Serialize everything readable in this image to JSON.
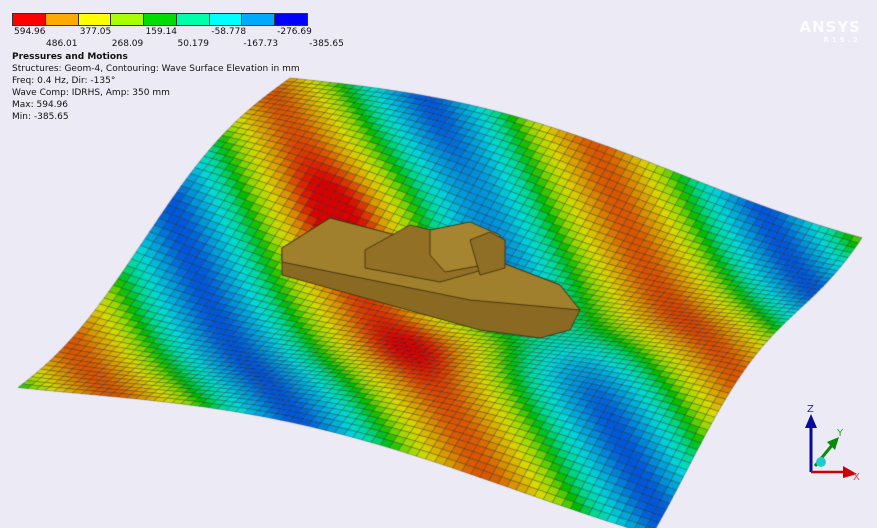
{
  "legend": {
    "colors": [
      "#ff0000",
      "#ffaa00",
      "#ffff00",
      "#aaff00",
      "#00dd00",
      "#00ffaa",
      "#00ffff",
      "#00aaff",
      "#0000ff"
    ],
    "top_labels": [
      "594.96",
      "377.05",
      "159.14",
      "-58.778",
      "-276.69"
    ],
    "bottom_labels": [
      "486.01",
      "268.09",
      "50.179",
      "-167.73",
      "-385.65"
    ]
  },
  "info": {
    "title": "Pressures and Motions",
    "line1": "Structures: Geom-4, Contouring: Wave Surface Elevation in mm",
    "line2": "Freq: 0.4 Hz, Dir: -135°",
    "line3": "Wave Comp: IDRHS, Amp: 350 mm",
    "line4": "Max: 594.96",
    "line5": "Min: -385.65"
  },
  "logo": {
    "text": "ANSYS"
  },
  "triad": {
    "x": "X",
    "y": "Y",
    "z": "Z"
  }
}
